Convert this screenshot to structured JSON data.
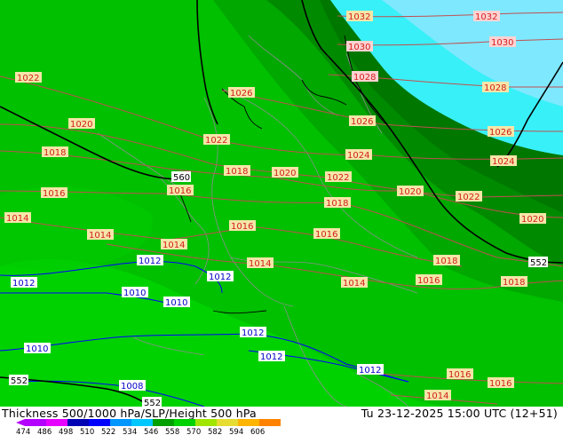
{
  "title": "Thickness 500/1000 hPa/SLP/Height 500 hPa",
  "valid_time": "Tu 23-12-2025 15:00 UTC (12+51)",
  "legend": {
    "values": [
      "474",
      "486",
      "498",
      "510",
      "522",
      "534",
      "546",
      "558",
      "570",
      "582",
      "594",
      "606"
    ],
    "colors": [
      "#b400ff",
      "#e600ff",
      "#0000b4",
      "#0000ff",
      "#0096ff",
      "#00c8ff",
      "#00a000",
      "#00d200",
      "#a0e600",
      "#e6dc32",
      "#ffb400",
      "#ff8200"
    ]
  },
  "colors": {
    "ocean_cyan": "#38f0f8",
    "ocean_light": "#7ee8ff",
    "green_dark": "#008000",
    "green_mid": "#00a000",
    "green_main": "#00c000",
    "green_light": "#00d200",
    "isobar": "#c05050",
    "height_contour": "#000000",
    "blue_isobar": "#0000ff"
  },
  "isobar_labels_red": [
    {
      "text": "1032"
    },
    {
      "text": "1032"
    },
    {
      "text": "1030"
    },
    {
      "text": "1030"
    },
    {
      "text": "1028"
    },
    {
      "text": "1028"
    },
    {
      "text": "1026"
    },
    {
      "text": "1026"
    },
    {
      "text": "1026"
    },
    {
      "text": "1024"
    },
    {
      "text": "1024"
    },
    {
      "text": "1022"
    },
    {
      "text": "1022"
    },
    {
      "text": "1022"
    },
    {
      "text": "1020"
    },
    {
      "text": "1020"
    },
    {
      "text": "1020"
    },
    {
      "text": "1020"
    },
    {
      "text": "1018"
    },
    {
      "text": "1018"
    },
    {
      "text": "1018"
    },
    {
      "text": "1018"
    },
    {
      "text": "1016"
    },
    {
      "text": "1016"
    },
    {
      "text": "1016"
    },
    {
      "text": "1016"
    },
    {
      "text": "1016"
    },
    {
      "text": "1016"
    },
    {
      "text": "1016"
    },
    {
      "text": "1014"
    },
    {
      "text": "1014"
    },
    {
      "text": "1014"
    },
    {
      "text": "1014"
    },
    {
      "text": "1014"
    },
    {
      "text": "1014"
    },
    {
      "text": "1022"
    },
    {
      "text": "1016"
    },
    {
      "text": "1018"
    }
  ],
  "isobar_labels_blue": [
    {
      "text": "1012"
    },
    {
      "text": "1012"
    },
    {
      "text": "1012"
    },
    {
      "text": "1012"
    },
    {
      "text": "1012"
    },
    {
      "text": "1012"
    },
    {
      "text": "1010"
    },
    {
      "text": "1010"
    },
    {
      "text": "1010"
    },
    {
      "text": "1008"
    }
  ],
  "height_labels": [
    {
      "text": "560"
    },
    {
      "text": "552"
    },
    {
      "text": "552"
    },
    {
      "text": "552"
    }
  ]
}
